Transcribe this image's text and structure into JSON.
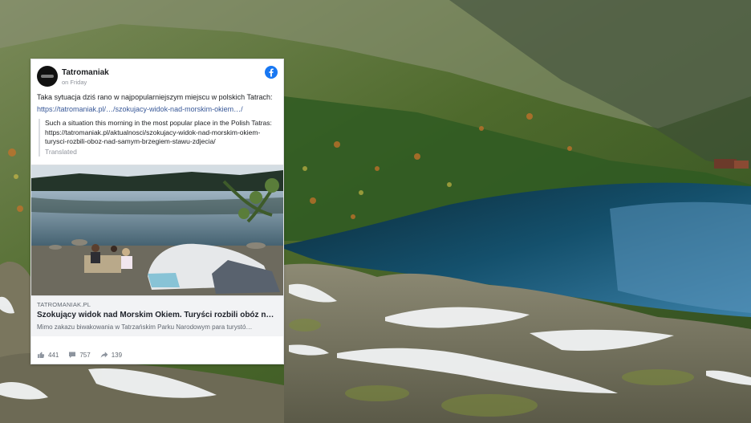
{
  "post": {
    "page_name": "Tatromaniak",
    "time": "on Friday",
    "text": "Taka sytuacja dziś rano w najpopularniejszym miejscu w polskich Tatrach:",
    "link": "https://tatromaniak.pl/…/szokujacy-widok-nad-morskim-okiem…/",
    "translation": "Such a situation this morning in the most popular place in the Polish Tatras: https://tatromaniak.pl/aktualnosci/szokujacy-widok-nad-morskim-okiem-turysci-rozbili-oboz-nad-samym-brzegiem-stawu-zdjecia/",
    "translated_label": "Translated",
    "icons": {
      "avatar": "page-avatar",
      "platform": "facebook-icon"
    }
  },
  "link_preview": {
    "domain": "TATROMANIAK.PL",
    "title": "Szokujący widok nad Morskim Okiem. Turyści rozbili obóz n…",
    "description": "Mimo zakazu biwakowania w Tatrzańskim Parku Narodowym para turystó…"
  },
  "stats": {
    "likes": "441",
    "comments": "757",
    "shares": "139",
    "icons": [
      "like-icon",
      "comment-icon",
      "share-icon"
    ]
  },
  "colors": {
    "link": "#385898",
    "facebook_blue": "#1877f2",
    "card_bg": "#ffffff",
    "link_box_bg": "#f2f3f5"
  }
}
